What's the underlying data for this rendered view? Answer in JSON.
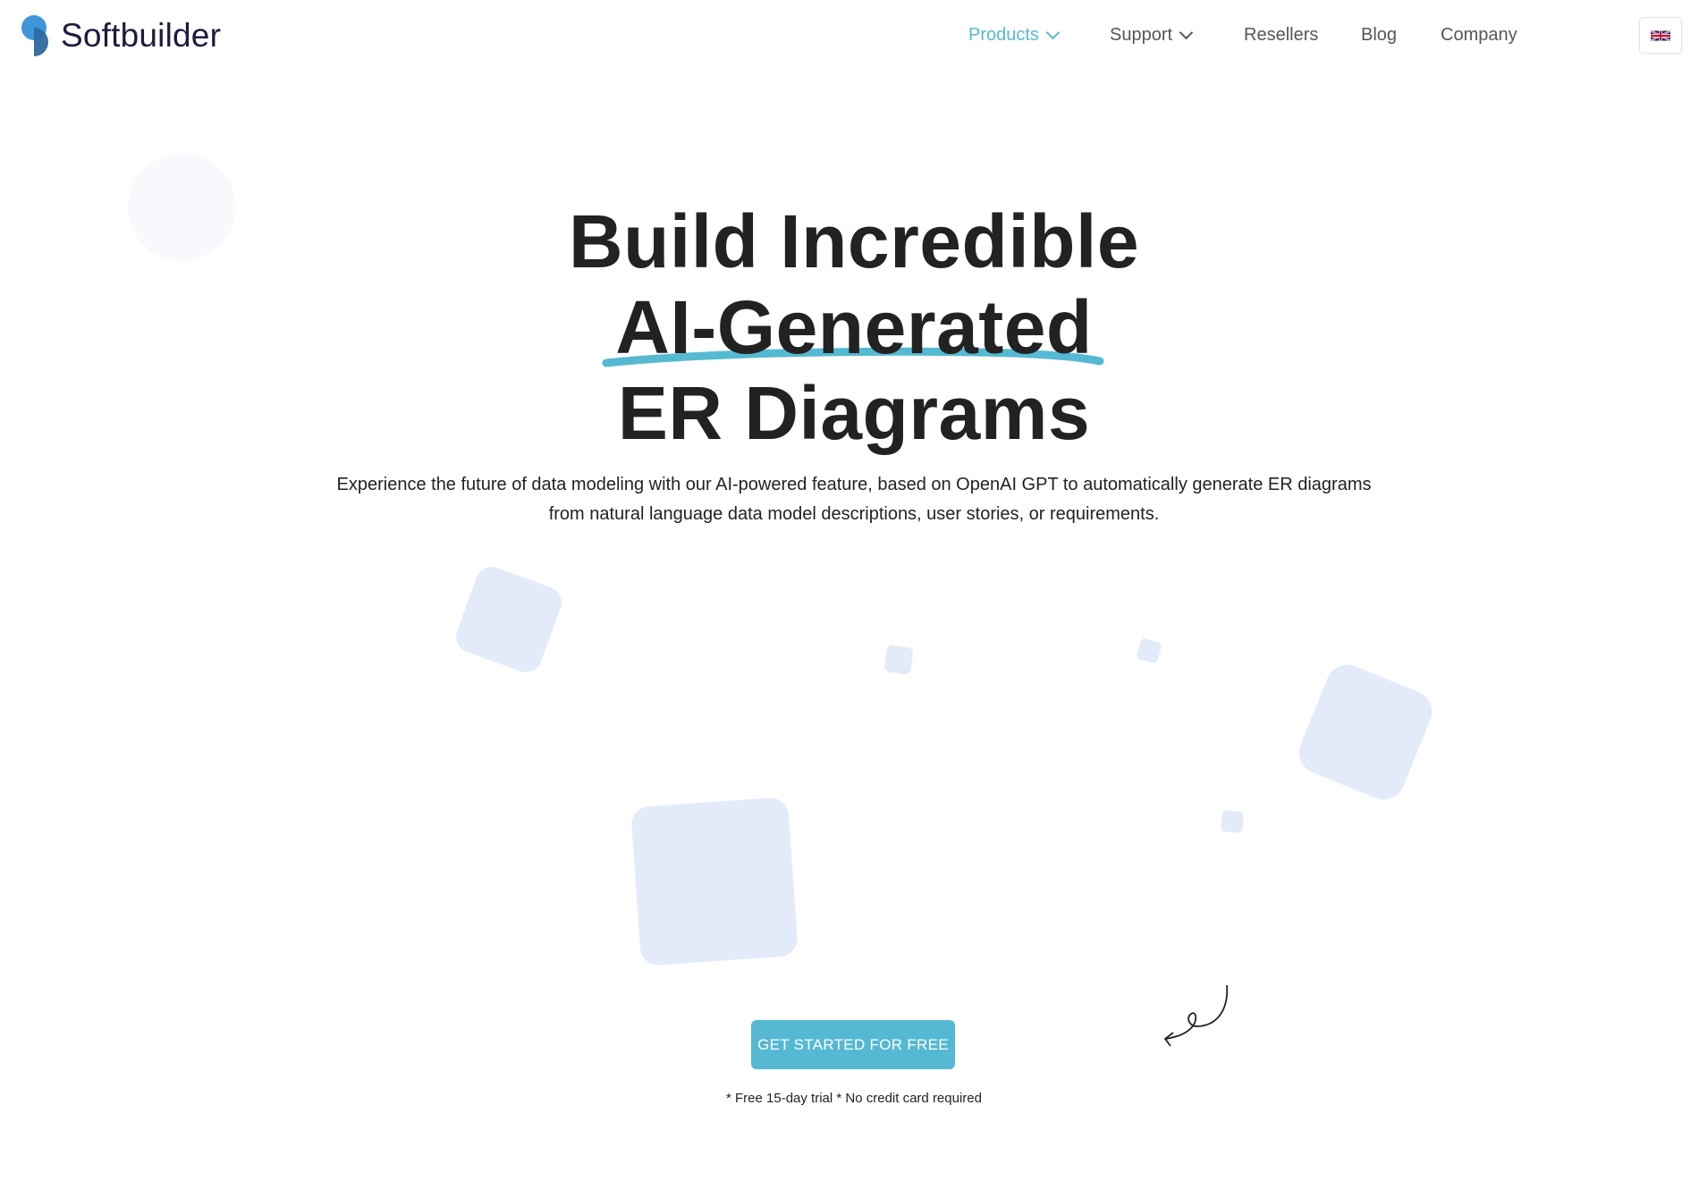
{
  "brand": {
    "name": "Softbuilder",
    "logo_colors": [
      "#3e95d8",
      "#2d6aa0"
    ]
  },
  "nav": {
    "items": [
      {
        "label": "Products",
        "has_dropdown": true,
        "active": true
      },
      {
        "label": "Support",
        "has_dropdown": true,
        "active": false
      },
      {
        "label": "Resellers",
        "has_dropdown": false,
        "active": false
      },
      {
        "label": "Blog",
        "has_dropdown": false,
        "active": false
      },
      {
        "label": "Company",
        "has_dropdown": false,
        "active": false
      }
    ],
    "language_icon": "uk-flag-icon"
  },
  "hero": {
    "title_line1": "Build Incredible",
    "title_line2": "AI-Generated",
    "title_line3": "ER Diagrams",
    "description": "Experience the future of data modeling with our AI-powered feature, based on OpenAI GPT to automatically generate ER diagrams from natural language data model descriptions, user stories, or requirements.",
    "cta_label": "GET STARTED FOR FREE",
    "note": "* Free 15-day trial * No credit card required"
  },
  "colors": {
    "accent": "#55b9d3",
    "text": "#222222",
    "shape": "#e3ebfb"
  }
}
